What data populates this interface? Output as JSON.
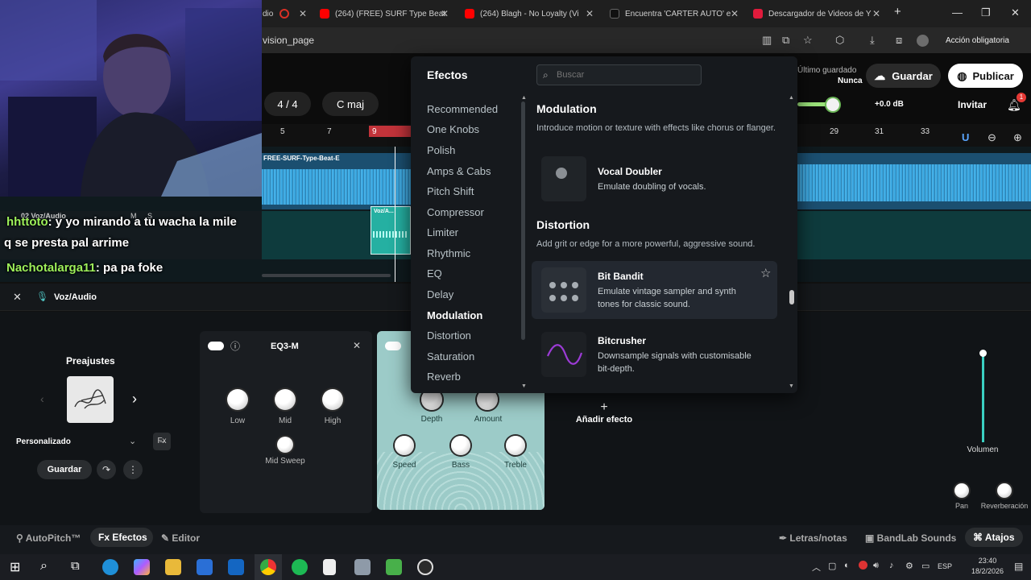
{
  "browser": {
    "tabs": [
      {
        "label": "dio",
        "fav_color": "#d93025"
      },
      {
        "label": "(264) (FREE) SURF Type Beat",
        "fav_color": "#ff0000"
      },
      {
        "label": "(264) Blagh - No Loyalty (Vi",
        "fav_color": "#ff0000"
      },
      {
        "label": "Encuentra 'CARTER AUTO' e",
        "fav_color": "#111111"
      },
      {
        "label": "Descargador de Videos de Y",
        "fav_color": "#e01b3c"
      }
    ],
    "url": "vision_page",
    "action_label": "Acción obligatoria"
  },
  "app": {
    "last_saved_label": "Último guardado",
    "last_saved_value": "Nunca",
    "save_label": "Guardar",
    "publish_label": "Publicar",
    "time_sig": "4 / 4",
    "key": "C maj",
    "db_readout": "+0.0 dB",
    "invite_label": "Invitar",
    "notif_count": "1",
    "ruler_left": [
      "5",
      "7",
      "9"
    ],
    "ruler_right": [
      "29",
      "31",
      "33"
    ],
    "clip_name": "FREE-SURF-Type-Beat-E",
    "small_clip": "Voz/A...",
    "track_label": "02 Voz/Audio",
    "track_buttons": [
      "M",
      "S"
    ],
    "selected_track": "Voz/Audio"
  },
  "effects_panel": {
    "title": "Efectos",
    "search_placeholder": "Buscar",
    "categories": [
      "Recommended",
      "One Knobs",
      "Polish",
      "Amps & Cabs",
      "Pitch Shift",
      "Compressor",
      "Limiter",
      "Rhythmic",
      "EQ",
      "Delay",
      "Modulation",
      "Distortion",
      "Saturation",
      "Reverb"
    ],
    "active_category": "Modulation",
    "sections": [
      {
        "title": "Modulation",
        "desc": "Introduce motion or texture with effects like chorus or flanger.",
        "items": [
          {
            "name": "Vocal Doubler",
            "desc": "Emulate doubling of vocals."
          }
        ]
      },
      {
        "title": "Distortion",
        "desc": "Add grit or edge for a more powerful, aggressive sound.",
        "items": [
          {
            "name": "Bit Bandit",
            "desc": "Emulate vintage sampler and synth tones for classic sound."
          },
          {
            "name": "Bitcrusher",
            "desc": "Downsample signals with customisable bit-depth."
          }
        ]
      }
    ]
  },
  "lower": {
    "presets_title": "Preajustes",
    "preset_name": "Personalizado",
    "save_label": "Guardar",
    "eq_title": "EQ3-M",
    "eq_knobs": [
      "Low",
      "Mid",
      "High"
    ],
    "eq_sweep": "Mid Sweep",
    "mod_knobs": [
      "Depth",
      "Amount",
      "Speed",
      "Bass",
      "Treble"
    ],
    "add_effect": "Añadir efecto",
    "volume_label": "Volumen",
    "pan_label": "Pan",
    "reverb_label": "Reverberación"
  },
  "bottombar": {
    "autopitch": "AutoPitch™",
    "efectos": "Efectos",
    "editor": "Editor",
    "lyrics": "Letras/notas",
    "sounds": "BandLab Sounds",
    "shortcuts": "Atajos"
  },
  "taskbar": {
    "lang": "ESP",
    "time": "23:40",
    "date": "18/2/2026"
  },
  "stream_chat": [
    {
      "user": "hhttoto",
      "msg": ": y yo mirando a tu wacha la mile"
    },
    {
      "user": "",
      "msg": "q se presta pal arrime"
    },
    {
      "user": "Nachotalarga11",
      "msg": ": pa pa foke"
    }
  ]
}
